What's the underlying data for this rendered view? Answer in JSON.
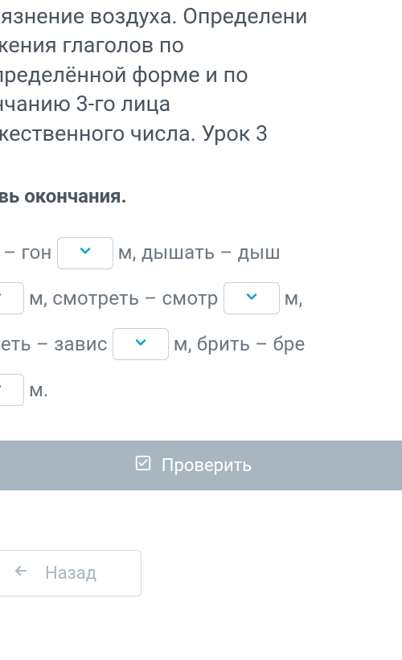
{
  "header": {
    "title": "агрязнение воздуха. Определени\nряжения глаголов по\nеопределённой форме и по\nкончанию 3-го лица\nножественного числа. Урок 3"
  },
  "instruction": "ставь окончания.",
  "exercise": {
    "lines": [
      {
        "segments": [
          "ать – гон",
          "{dd}",
          "м, дышать – дыш"
        ]
      },
      {
        "segments": [
          "{dd}",
          "м, смотреть – смотр",
          "{dd}",
          "м,"
        ]
      },
      {
        "segments": [
          "висеть – завис",
          "{dd}",
          "м, брить – бре"
        ]
      },
      {
        "segments": [
          "{dd}",
          "м."
        ]
      }
    ]
  },
  "buttons": {
    "check": "Проверить",
    "back": "Назад"
  },
  "icons": {
    "chevron_color": "#0ea5c6",
    "check_color": "#ffffff",
    "back_color": "#a9b6bf"
  }
}
